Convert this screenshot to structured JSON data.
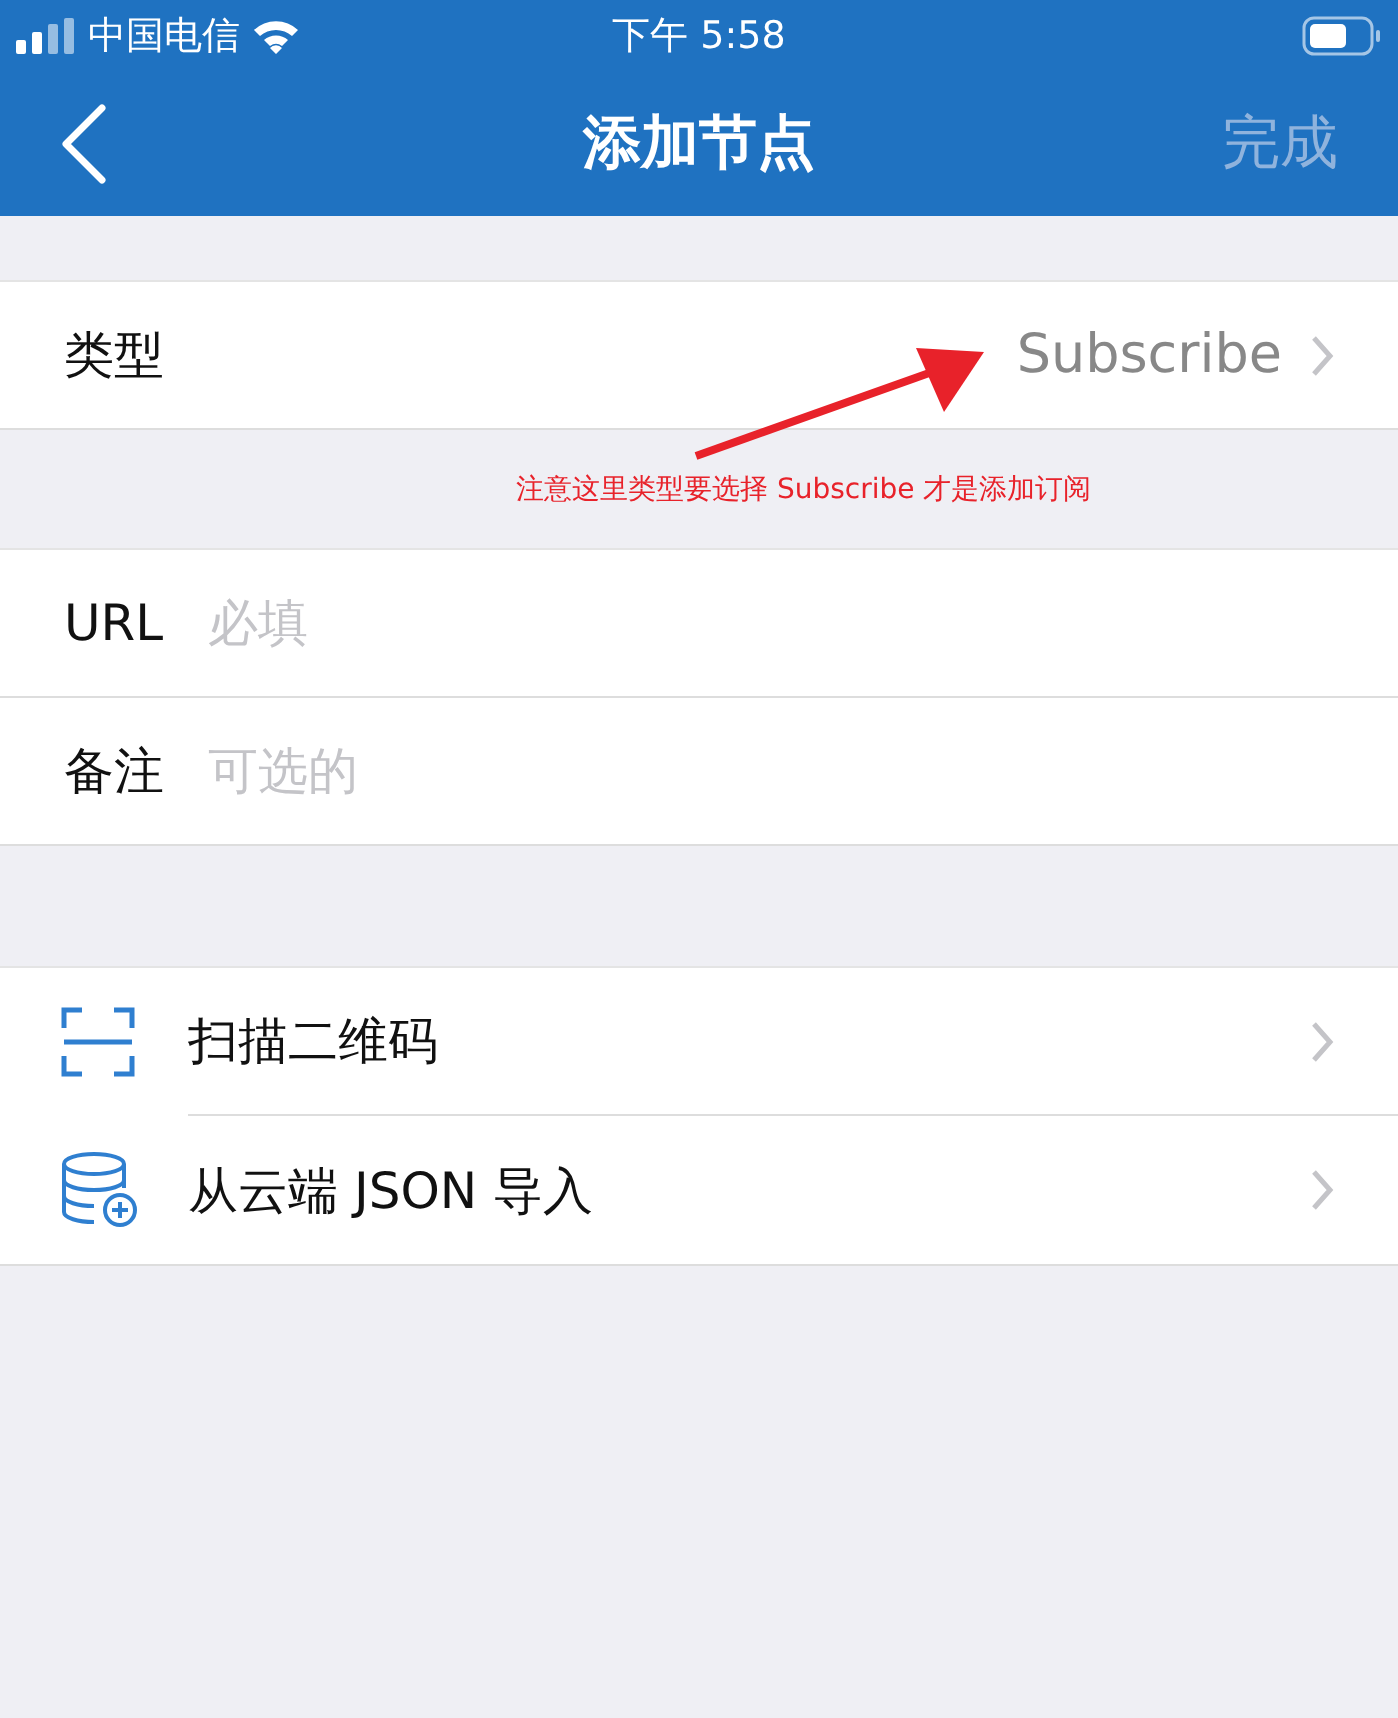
{
  "status_bar": {
    "carrier": "中国电信",
    "time": "下午 5:58"
  },
  "nav": {
    "title": "添加节点",
    "done": {
      "label": "完成",
      "disabled": true
    }
  },
  "type_row": {
    "label": "类型",
    "value": "Subscribe"
  },
  "annotation": {
    "text": "注意这里类型要选择 Subscribe 才是添加订阅"
  },
  "fields": [
    {
      "label": "URL",
      "placeholder": "必填"
    },
    {
      "label": "备注",
      "placeholder": "可选的"
    }
  ],
  "actions": [
    {
      "label": "扫描二维码",
      "kind": "scan"
    },
    {
      "label": "从云端 JSON 导入",
      "kind": "json"
    }
  ]
}
